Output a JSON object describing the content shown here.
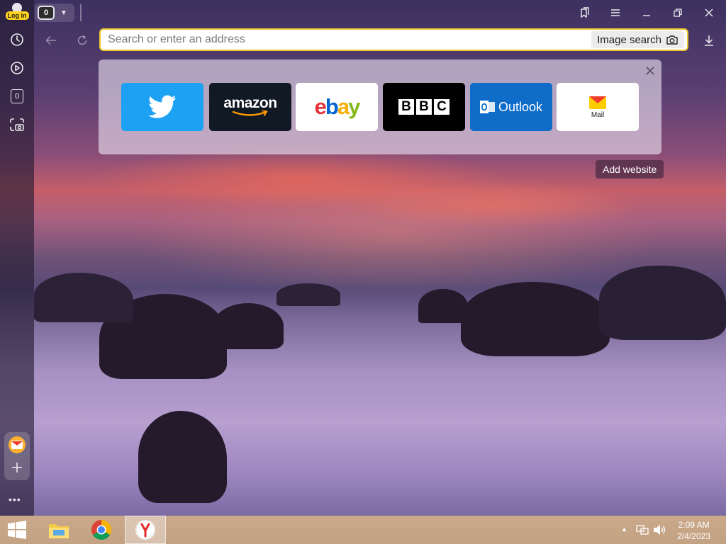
{
  "sidebar": {
    "login_label": "Log in",
    "items": [
      {
        "name": "history-icon"
      },
      {
        "name": "play-icon"
      },
      {
        "name": "counter-icon",
        "value": "0"
      },
      {
        "name": "screenshot-icon"
      }
    ],
    "more_label": "•••"
  },
  "topbar": {
    "tab_count": "0",
    "address_placeholder": "Search or enter an address",
    "image_search_label": "Image search"
  },
  "speed_dial": {
    "tiles": [
      {
        "name": "twitter"
      },
      {
        "name": "amazon",
        "label": "amazon"
      },
      {
        "name": "ebay"
      },
      {
        "name": "bbc",
        "letters": [
          "B",
          "B",
          "C"
        ]
      },
      {
        "name": "outlook",
        "label": "Outlook"
      },
      {
        "name": "mail",
        "label": "Mail"
      }
    ],
    "add_website_label": "Add website"
  },
  "taskbar": {
    "time": "2:09 AM",
    "date": "2/4/2023"
  },
  "colors": {
    "accent": "#f2c52e",
    "twitter": "#1da1f2",
    "outlook": "#0f6cc9"
  }
}
